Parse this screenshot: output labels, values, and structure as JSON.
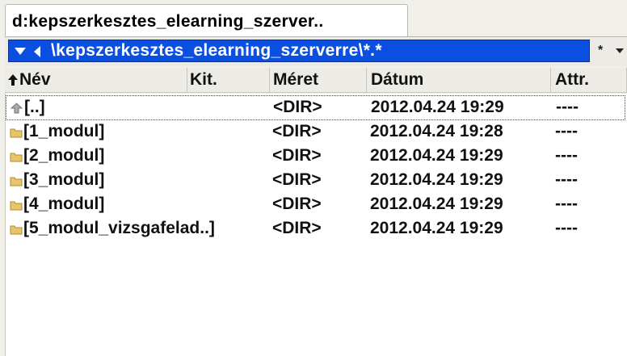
{
  "tab": {
    "title": "d:kepszerkesztes_elearning_szerver.."
  },
  "path": {
    "text": "\\kepszerkesztes_elearning_szerverre\\*.*"
  },
  "filter": {
    "text": "*"
  },
  "columns": {
    "name": "Név",
    "ext": "Kit.",
    "size": "Méret",
    "date": "Dátum",
    "attr": "Attr."
  },
  "rows": [
    {
      "icon": "up-folder-icon",
      "name": "[..]",
      "size": "<DIR>",
      "date": "2012.04.24 19:29",
      "attr": "----"
    },
    {
      "icon": "folder-icon",
      "name": "[1_modul]",
      "size": "<DIR>",
      "date": "2012.04.24 19:28",
      "attr": "----"
    },
    {
      "icon": "folder-icon",
      "name": "[2_modul]",
      "size": "<DIR>",
      "date": "2012.04.24 19:29",
      "attr": "----"
    },
    {
      "icon": "folder-icon",
      "name": "[3_modul]",
      "size": "<DIR>",
      "date": "2012.04.24 19:29",
      "attr": "----"
    },
    {
      "icon": "folder-icon",
      "name": "[4_modul]",
      "size": "<DIR>",
      "date": "2012.04.24 19:29",
      "attr": "----"
    },
    {
      "icon": "folder-icon",
      "name": "[5_modul_vizsgafelad..]",
      "size": "<DIR>",
      "date": "2012.04.24 19:29",
      "attr": "----"
    }
  ],
  "colors": {
    "path_bg": "#0a4fe0",
    "folder": "#e8c56a"
  }
}
